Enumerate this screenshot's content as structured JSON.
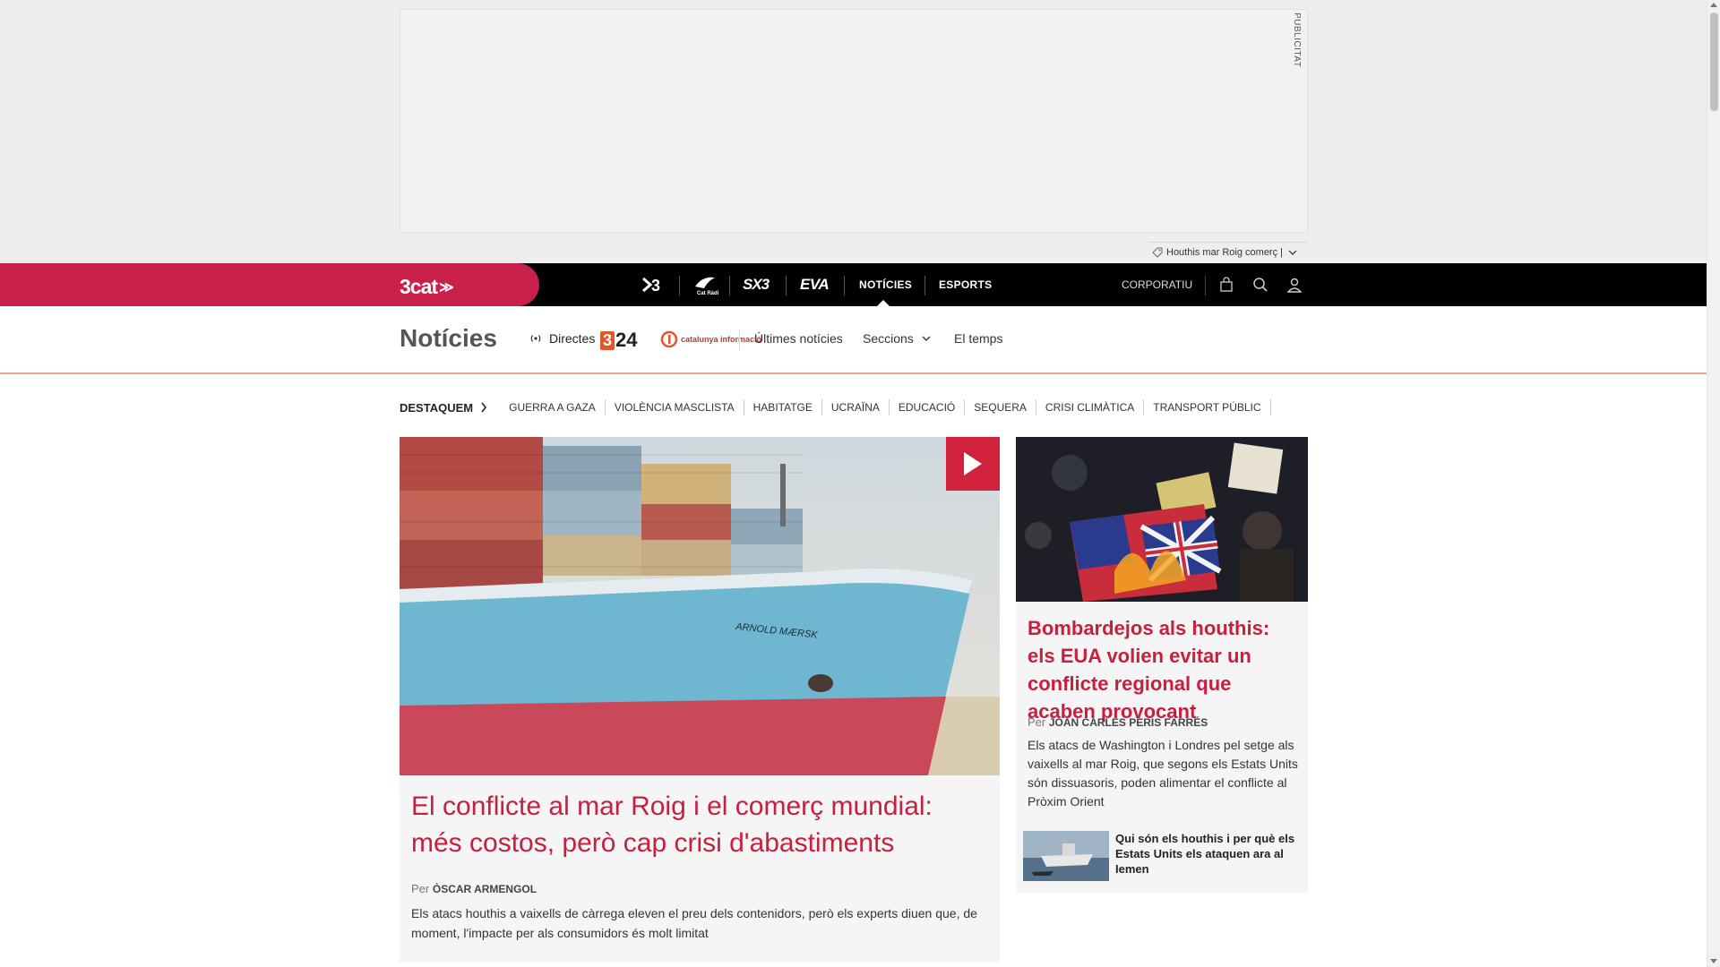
{
  "ad": {
    "label": "PUBLICITAT",
    "topic_text": "Houthis mar Roig comerç |"
  },
  "topnav": {
    "logo": "3cat",
    "channels": [
      "3",
      "Cat Ràdio",
      "SX3",
      "EVA"
    ],
    "links": [
      "NOTÍCIES",
      "ESPORTS"
    ],
    "active": "NOTÍCIES",
    "corporatiu": "CORPORATIU",
    "icons": [
      "shopping-bag-icon",
      "search-icon",
      "user-icon"
    ]
  },
  "section": {
    "title": "Notícies",
    "directes": "Directes",
    "logo_324": "24",
    "logo_324_prefix": "3",
    "logo_ci": "catalunya informació",
    "links": [
      "Últimes notícies",
      "Seccions",
      "El temps"
    ]
  },
  "tags": {
    "label": "DESTAQUEM",
    "items": [
      "GUERRA A GAZA",
      "VIOLÈNCIA MASCLISTA",
      "HABITATGE",
      "UCRAÏNA",
      "EDUCACIÓ",
      "SEQUERA",
      "CRISI CLIMÀTICA",
      "TRANSPORT PÚBLIC"
    ]
  },
  "main_article": {
    "title": "El conflicte al mar Roig i el comerç mundial: més costos, però cap crisi d'abastiments",
    "by": "Per",
    "author": "Òscar Armengol",
    "summary": "Els atacs houthis a vaixells de càrrega eleven el preu dels contenidors, però els experts diuen que, de moment, l'impacte per als consumidors és molt limitat",
    "ship_name": "ARNOLD MÆRSK"
  },
  "side_article": {
    "title": "Bombardejos als houthis: els EUA volien evitar un conflicte regional que acaben provocant",
    "by": "Per",
    "author": "Joan Carles Peris Farrés",
    "summary": "Els atacs de Washington i Londres pel setge als vaixells al mar Roig, que segons els Estats Units són dissuasoris, poden alimentar el conflicte al Pròxim Orient",
    "related_title": "Qui són els houthis i per què els Estats Units els ataquen ara al Iemen"
  },
  "colors": {
    "brand_red": "#c8204a",
    "headline_red": "#c61f3f",
    "nav_black": "#000000",
    "section_line": "#e9a68a"
  }
}
